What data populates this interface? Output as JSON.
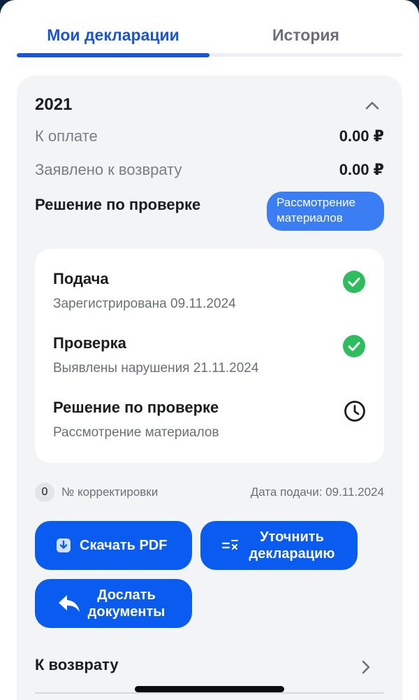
{
  "tabs": [
    {
      "label": "Мои декларации",
      "active": true
    },
    {
      "label": "История",
      "active": false
    }
  ],
  "declaration": {
    "year": "2021",
    "to_pay_label": "К оплате",
    "to_pay_value": "0.00 ₽",
    "claimed_refund_label": "Заявлено к возврату",
    "claimed_refund_value": "0.00 ₽",
    "decision_label": "Решение по проверке",
    "status_badge": {
      "line1": "Рассмотрение",
      "line2": "материалов"
    },
    "timeline": [
      {
        "title": "Подача",
        "subtitle": "Зарегистрирована 09.11.2024",
        "state": "done",
        "icon": "check-circle-icon"
      },
      {
        "title": "Проверка",
        "subtitle": "Выявлены нарушения 21.11.2024",
        "state": "done",
        "icon": "check-circle-icon"
      },
      {
        "title": "Решение по проверке",
        "subtitle": "Рассмотрение материалов",
        "state": "pending",
        "icon": "clock-icon"
      }
    ],
    "correction_count": "0",
    "correction_label": "№ корректировки",
    "submission_date": "Дата подачи: 09.11.2024",
    "buttons": {
      "download_pdf": "Скачать PDF",
      "clarify_line1": "Уточнить",
      "clarify_line2": "декларацию",
      "send_docs_line1": "Дослать",
      "send_docs_line2": "документы"
    },
    "refund_row_label": "К возврату"
  },
  "colors": {
    "accent": "#1a55d6",
    "button": "#0a5bf0",
    "badge": "#3b7df3",
    "success": "#2dbd5f",
    "card_bg": "#f3f4f6"
  }
}
